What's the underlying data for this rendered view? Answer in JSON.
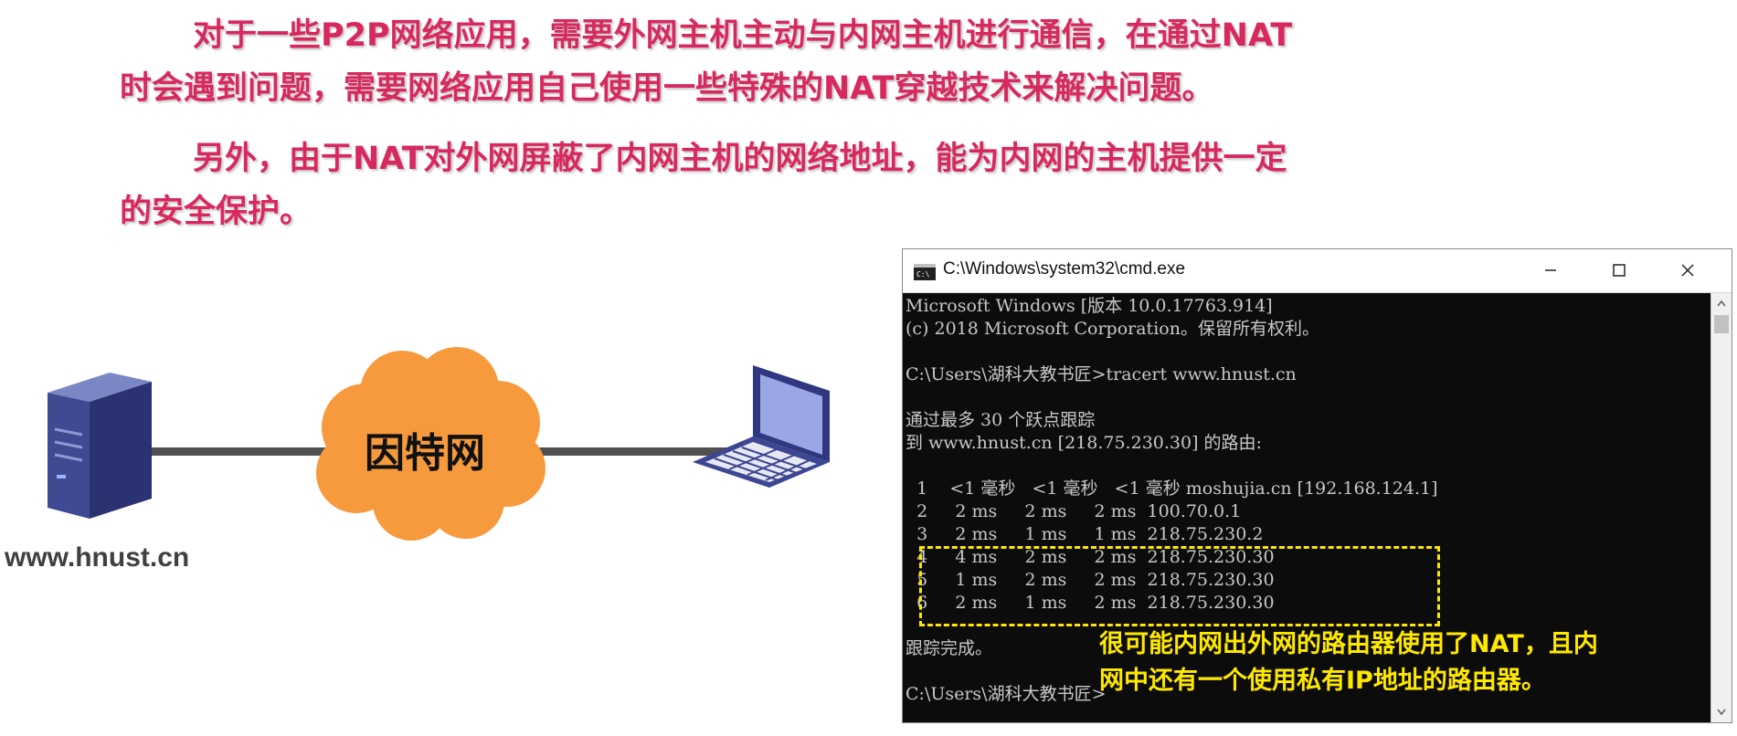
{
  "paragraphs": [
    {
      "lines": [
        "对于一些P2P网络应用，需要外网主机主动与内网主机进行通信，在通过NAT",
        "时会遇到问题，需要网络应用自己使用一些特殊的NAT穿越技术来解决问题。"
      ]
    },
    {
      "lines": [
        "另外，由于NAT对外网屏蔽了内网主机的网络地址，能为内网的主机提供一定",
        "的安全保护。"
      ]
    }
  ],
  "diagram": {
    "cloud_label": "因特网",
    "server_label": "www.hnust.cn",
    "server_icon": "server-tower-icon",
    "laptop_icon": "laptop-icon",
    "cloud_color": "#f79a3e",
    "link_color": "#505050"
  },
  "cmd": {
    "title": "C:\\Windows\\system32\\cmd.exe",
    "lines": [
      "Microsoft Windows [版本 10.0.17763.914]",
      "(c) 2018 Microsoft Corporation。保留所有权利。",
      "",
      "C:\\Users\\湖科大教书匠>tracert www.hnust.cn",
      "",
      "通过最多 30 个跃点跟踪",
      "到 www.hnust.cn [218.75.230.30] 的路由:",
      "",
      "  1    <1 毫秒   <1 毫秒   <1 毫秒 moshujia.cn [192.168.124.1]",
      "  2     2 ms     2 ms     2 ms  100.70.0.1",
      "  3     2 ms     1 ms     1 ms  218.75.230.2",
      "  4     4 ms     2 ms     2 ms  218.75.230.30",
      "  5     1 ms     2 ms     2 ms  218.75.230.30",
      "  6     2 ms     1 ms     2 ms  218.75.230.30",
      "",
      "跟踪完成。",
      "",
      "C:\\Users\\湖科大教书匠>"
    ]
  },
  "annotation": {
    "lines": [
      "很可能内网出外网的路由器使用了NAT，且内",
      "网中还有一个使用私有IP地址的路由器。"
    ],
    "color": "#ffe800"
  },
  "colors": {
    "heading_text": "#d8295f",
    "console_bg": "#0c0c0c",
    "console_text": "#c8c8c8"
  }
}
